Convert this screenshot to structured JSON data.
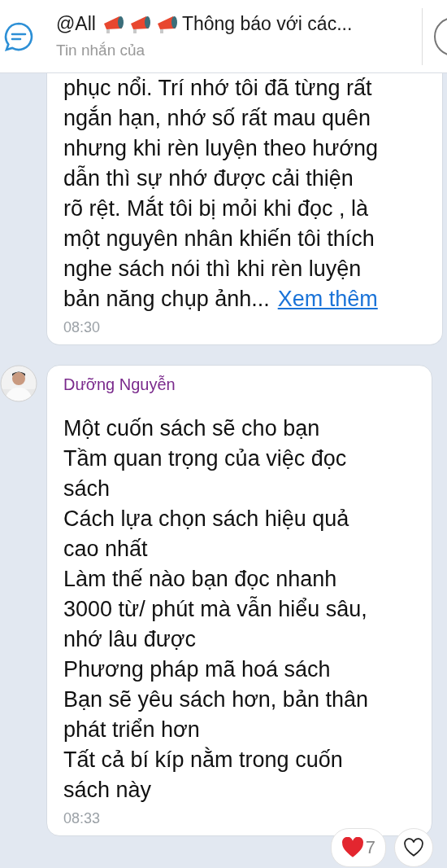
{
  "header": {
    "mention": "@All",
    "title": "Thông báo với các...",
    "subtitle": "Tin nhắn của"
  },
  "messages": [
    {
      "lines": [
        "phục nổi. Trí nhớ tôi đã từng rất",
        "ngắn hạn, nhớ số rất mau quên",
        "nhưng khi rèn luyện theo hướng",
        "dẫn thì sự nhớ được cải thiện",
        "rõ rệt. Mắt tôi bị mỏi khi đọc , là",
        "một nguyên nhân khiến tôi thích",
        "nghe sách nói thì khi rèn luyện",
        "bản năng chụp ảnh..."
      ],
      "more_link": "Xem thêm",
      "time": "08:30"
    },
    {
      "sender": "Dưỡng Nguyễn",
      "lines": [
        "Một cuốn sách sẽ cho bạn",
        "Tầm quan trọng của việc đọc",
        "sách",
        "Cách lựa chọn sách hiệu quả",
        "cao nhất",
        "Làm thế nào bạn đọc nhanh",
        "3000 từ/ phút mà vẫn hiểu sâu,",
        "nhớ lâu được",
        "Phương pháp mã hoá sách",
        "Bạn sẽ yêu sách hơn, bản thân",
        "phát triển hơn",
        "Tất cả bí kíp nằm trong cuốn",
        "sách này"
      ],
      "time": "08:33",
      "reaction_count": "7"
    }
  ]
}
